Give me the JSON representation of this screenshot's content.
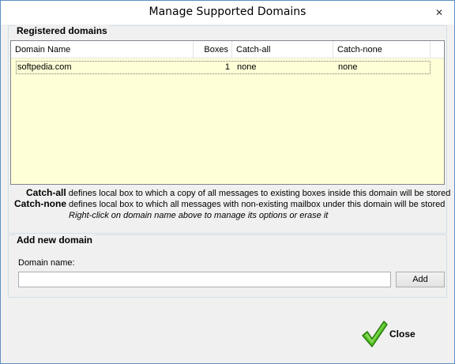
{
  "window": {
    "title": "Manage Supported Domains",
    "close_glyph": "✕"
  },
  "registered": {
    "group_label": "Registered domains",
    "columns": [
      "Domain Name",
      "Boxes",
      "Catch-all",
      "Catch-none"
    ],
    "rows": [
      {
        "domain": "softpedia.com",
        "boxes": "1",
        "catch_all": "none",
        "catch_none": "none"
      }
    ]
  },
  "notes": {
    "catch_all_term": "Catch-all",
    "catch_all_text": " defines local box to which a copy of all messages to existing boxes inside this domain will be stored",
    "catch_none_term": "Catch-none",
    "catch_none_text": " defines local box to which all messages with non-existing mailbox under this domain will be stored",
    "hint": "Right-click on domain name above to manage its options or erase it"
  },
  "add_domain": {
    "group_label": "Add new domain",
    "field_label": "Domain name:",
    "value": "",
    "button": "Add"
  },
  "footer": {
    "close_label": "Close",
    "icon": "checkmark-icon",
    "icon_color": "#4fbf1f"
  },
  "colors": {
    "list_bg": "#ffffd7",
    "border": "#5f8fc7"
  }
}
